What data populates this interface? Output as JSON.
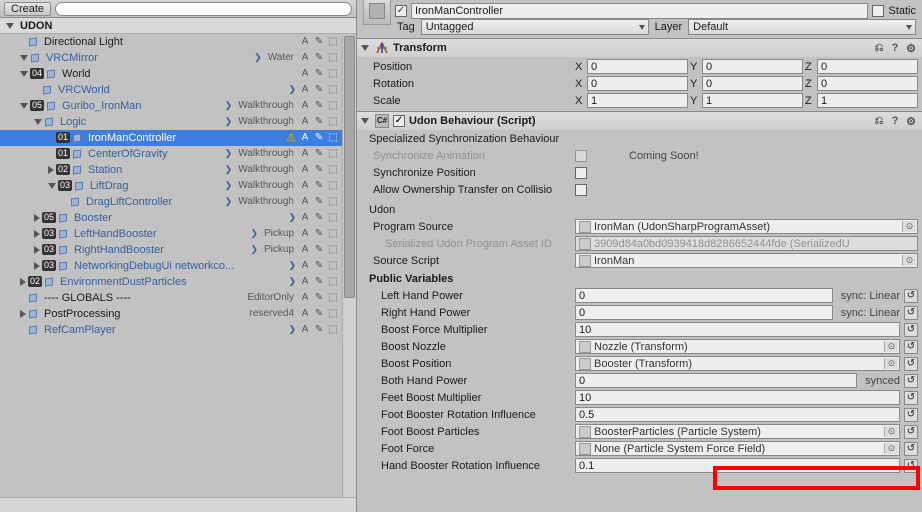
{
  "hierarchy": {
    "create_label": "Create",
    "scene_name": "UDON",
    "rows": [
      {
        "depth": 1,
        "tri": "s",
        "name": "Directional Light",
        "prefab": false,
        "tag": "",
        "letter": "A"
      },
      {
        "depth": 1,
        "tri": "o",
        "name": "VRCMirror",
        "prefab": true,
        "tag": "Water",
        "letter": "A"
      },
      {
        "depth": 1,
        "tri": "o",
        "name": "World",
        "prefab": false,
        "badge": "04",
        "tag": "",
        "letter": "A"
      },
      {
        "depth": 2,
        "tri": "s",
        "name": "VRCWorld",
        "prefab": true,
        "tag": "",
        "letter": "A"
      },
      {
        "depth": 1,
        "tri": "o",
        "name": "Guribo_IronMan",
        "prefab": true,
        "badge": "05",
        "tag": "Walkthrough",
        "letter": "A"
      },
      {
        "depth": 2,
        "tri": "o",
        "name": "Logic",
        "prefab": true,
        "tag": "Walkthrough",
        "letter": "A"
      },
      {
        "depth": 3,
        "tri": "s",
        "name": "IronManController",
        "prefab": true,
        "badge": "01",
        "sel": true,
        "warn": true,
        "tag": "",
        "letter": "A"
      },
      {
        "depth": 3,
        "tri": "s",
        "name": "CenterOfGravity",
        "prefab": true,
        "badge": "01",
        "tag": "Walkthrough",
        "letter": "A"
      },
      {
        "depth": 3,
        "tri": "c",
        "name": "Station",
        "prefab": true,
        "badge": "02",
        "tag": "Walkthrough",
        "letter": "A"
      },
      {
        "depth": 3,
        "tri": "o",
        "name": "LiftDrag",
        "prefab": true,
        "badge": "03",
        "tag": "Walkthrough",
        "letter": "A"
      },
      {
        "depth": 4,
        "tri": "s",
        "name": "DragLiftController",
        "prefab": true,
        "tag": "Walkthrough",
        "letter": "A"
      },
      {
        "depth": 2,
        "tri": "c",
        "name": "Booster",
        "prefab": true,
        "badge": "05",
        "tag": "",
        "letter": "A"
      },
      {
        "depth": 2,
        "tri": "c",
        "name": "LeftHandBooster",
        "prefab": true,
        "badge": "03",
        "tag": "Pickup",
        "letter": "A"
      },
      {
        "depth": 2,
        "tri": "c",
        "name": "RightHandBooster",
        "prefab": true,
        "badge": "03",
        "tag": "Pickup",
        "letter": "A"
      },
      {
        "depth": 2,
        "tri": "c",
        "name": "NetworkingDebugUi networkco...",
        "prefab": true,
        "badge": "03",
        "tag": "",
        "letter": "A"
      },
      {
        "depth": 1,
        "tri": "c",
        "name": "EnvironmentDustParticles",
        "prefab": true,
        "badge": "02",
        "tag": "",
        "letter": "A"
      },
      {
        "depth": 1,
        "tri": "s",
        "name": "---- GLOBALS ----",
        "prefab": false,
        "tag": "EditorOnly",
        "letter": "A"
      },
      {
        "depth": 1,
        "tri": "c",
        "name": "PostProcessing",
        "prefab": false,
        "tag": "reserved4",
        "letter": "A"
      },
      {
        "depth": 1,
        "tri": "s",
        "name": "RefCamPlayer",
        "prefab": true,
        "tag": "",
        "letter": "A"
      }
    ]
  },
  "inspector": {
    "object_name": "IronManController",
    "static_label": "Static",
    "tag_label": "Tag",
    "tag_value": "Untagged",
    "layer_label": "Layer",
    "layer_value": "Default"
  },
  "transform": {
    "title": "Transform",
    "position": "Position",
    "rotation": "Rotation",
    "scale": "Scale",
    "px": "0",
    "py": "0",
    "pz": "0",
    "rx": "0",
    "ry": "0",
    "rz": "0",
    "sx": "1",
    "sy": "1",
    "sz": "1"
  },
  "udon": {
    "title": "Udon Behaviour (Script)",
    "sync_header": "Specialized Synchronization Behaviour",
    "sync_anim": "Synchronize Animation",
    "coming_soon": "Coming Soon!",
    "sync_pos": "Synchronize Position",
    "allow_own": "Allow Ownership Transfer on Collisio",
    "udon_header": "Udon",
    "prog_src_label": "Program Source",
    "prog_src_value": "IronMan (UdonSharpProgramAsset)",
    "ser_label": "Serialized Udon Program Asset ID",
    "ser_value": "3909d84a0bd0939418d8286652444fde (SerializedU",
    "src_script_label": "Source Script",
    "src_script_value": "IronMan",
    "pubvar_header": "Public Variables",
    "vars": [
      {
        "label": "Left Hand Power",
        "val": "0",
        "extra": "sync: Linear"
      },
      {
        "label": "Right Hand Power",
        "val": "0",
        "extra": "sync: Linear"
      },
      {
        "label": "Boost Force Multiplier",
        "val": "10",
        "extra": ""
      },
      {
        "label": "Boost Nozzle",
        "ref": "Nozzle (Transform)"
      },
      {
        "label": "Boost Position",
        "ref": "Booster (Transform)"
      },
      {
        "label": "Both Hand Power",
        "val": "0",
        "extra": "synced"
      },
      {
        "label": "Feet Boost Multiplier",
        "val": "10",
        "extra": ""
      },
      {
        "label": "Foot Booster Rotation Influence",
        "val": "0.5",
        "extra": ""
      },
      {
        "label": "Foot Boost Particles",
        "ref": "BoosterParticles (Particle System)"
      },
      {
        "label": "Foot Force",
        "ref": "None (Particle System Force Field)"
      },
      {
        "label": "Hand Booster Rotation Influence",
        "val": "0.1",
        "extra": ""
      }
    ]
  }
}
